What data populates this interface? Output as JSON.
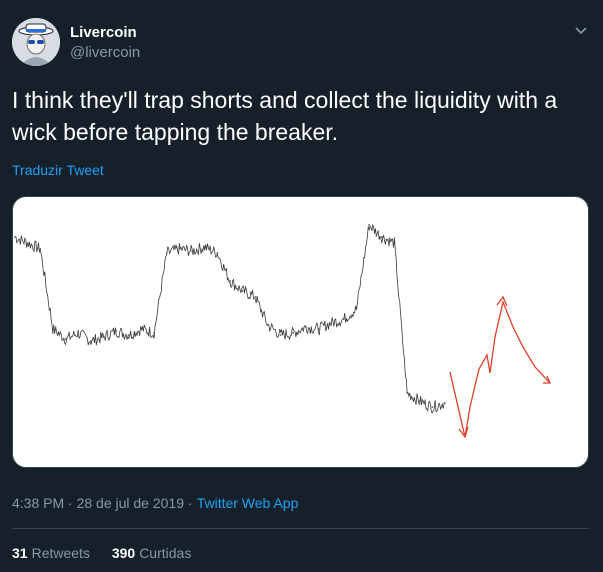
{
  "tweet": {
    "author": {
      "name": "Livercoin",
      "handle": "@livercoin"
    },
    "text": "I think they'll trap shorts and collect the liquidity with a wick before tapping the breaker.",
    "translate_label": "Traduzir Tweet",
    "timestamp": "4:38 PM · 28 de jul de 2019",
    "source": "Twitter Web App",
    "retweets_count": "31",
    "retweets_label": "Retweets",
    "likes_count": "390",
    "likes_label": "Curtidas"
  },
  "icons": {
    "menu": "chevron-down-icon"
  },
  "colors": {
    "background": "#15202b",
    "link": "#1da1f2",
    "muted": "#8899a6",
    "annotation": "#e0402a"
  },
  "chart_data": {
    "type": "line",
    "title": "",
    "xlabel": "",
    "ylabel": "",
    "x": [
      0,
      1,
      2,
      3,
      4,
      5,
      6,
      7,
      8,
      9,
      10,
      11,
      12,
      13,
      14,
      15,
      16,
      17,
      18,
      19,
      20,
      21,
      22,
      23,
      24,
      25,
      26,
      27,
      28,
      29,
      30,
      31,
      32,
      33,
      34
    ],
    "series": [
      {
        "values": [
          96,
          93,
          90,
          50,
          45,
          48,
          44,
          46,
          49,
          47,
          50,
          48,
          88,
          90,
          89,
          91,
          88,
          74,
          69,
          66,
          52,
          47,
          48,
          51,
          50,
          53,
          55,
          60,
          102,
          96,
          93,
          18,
          14,
          11,
          13
        ]
      }
    ],
    "ylim": [
      0,
      110
    ],
    "grid": false
  }
}
